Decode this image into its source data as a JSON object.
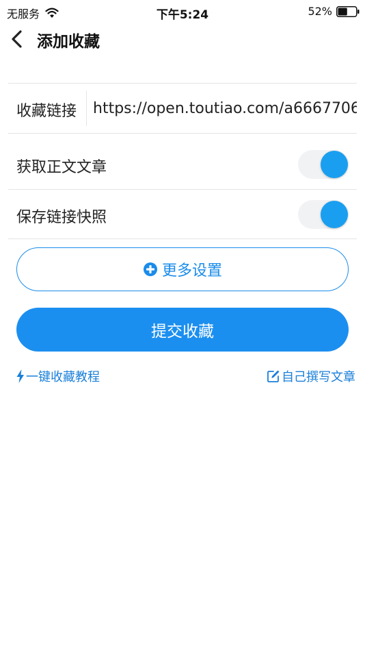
{
  "status_bar": {
    "carrier": "无服务",
    "time": "下午5:24",
    "battery_percent": "52%",
    "battery_level": 0.52
  },
  "nav": {
    "title": "添加收藏"
  },
  "form": {
    "link_label": "收藏链接",
    "link_value": "https://open.toutiao.com/a6667706",
    "fetch_article_label": "获取正文文章",
    "fetch_article_on": true,
    "snapshot_label": "保存链接快照",
    "snapshot_on": true
  },
  "buttons": {
    "more_settings": "更多设置",
    "submit": "提交收藏"
  },
  "links": {
    "tutorial": "一键收藏教程",
    "write_article": "自己撰写文章"
  },
  "colors": {
    "accent": "#1b8ff0",
    "toggle_knob": "#1a9ff0",
    "toggle_track": "#f1f2f4"
  }
}
